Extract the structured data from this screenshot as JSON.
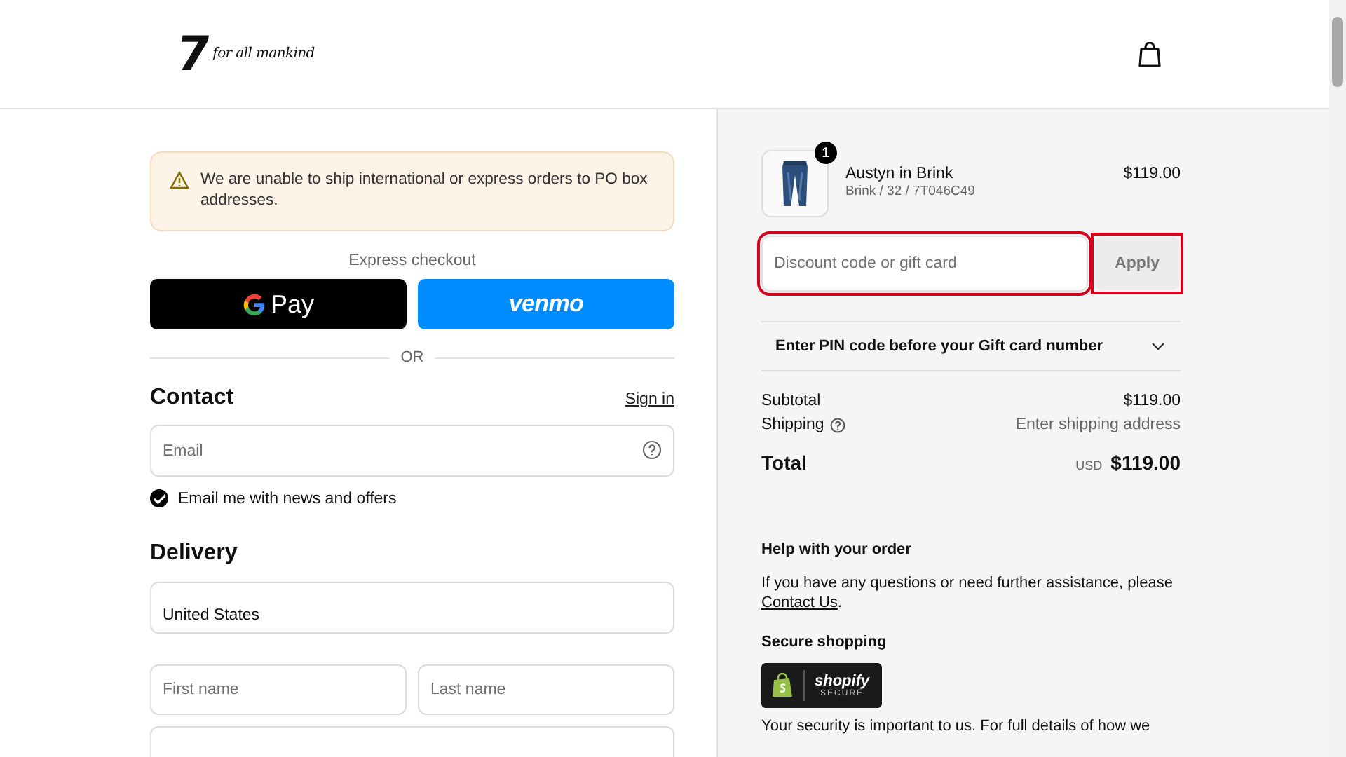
{
  "header": {
    "logo": {
      "mark": "7",
      "text": "for all mankind"
    }
  },
  "notice": {
    "text": "We are unable to ship international or express orders to PO box addresses."
  },
  "express_checkout": {
    "title": "Express checkout",
    "buttons": [
      {
        "kind": "gpay",
        "label": "Pay"
      },
      {
        "kind": "venmo",
        "label": "venmo"
      }
    ],
    "divider": "OR"
  },
  "contact": {
    "title": "Contact",
    "sign_in": "Sign in",
    "email": {
      "placeholder": "Email"
    },
    "newsletter": {
      "label": "Email me with news and offers",
      "checked": true
    }
  },
  "delivery": {
    "title": "Delivery",
    "country": {
      "value": "United States"
    },
    "first_name": {
      "placeholder": "First name"
    },
    "last_name": {
      "placeholder": "Last name"
    }
  },
  "order": {
    "item": {
      "name": "Austyn in Brink",
      "variant": "Brink / 32 / 7T046C49",
      "price": "$119.00",
      "quantity": "1"
    },
    "discount": {
      "placeholder": "Discount code or gift card",
      "button": "Apply",
      "highlighted": true
    },
    "pin_section": {
      "label": "Enter PIN code before your Gift card number",
      "expanded": false
    },
    "subtotal": {
      "label": "Subtotal",
      "value": "$119.00"
    },
    "shipping": {
      "label": "Shipping",
      "value": "Enter shipping address"
    },
    "total": {
      "label": "Total",
      "currency": "USD",
      "value": "$119.00"
    }
  },
  "help": {
    "title": "Help with your order",
    "text": "If you have any questions or need further assistance, please",
    "link": "Contact Us",
    "after": "."
  },
  "secure": {
    "title": "Secure shopping",
    "badge": {
      "name": "shopify",
      "sub": "SECURE"
    },
    "text": "Your security is important to us. For full details of how we"
  }
}
